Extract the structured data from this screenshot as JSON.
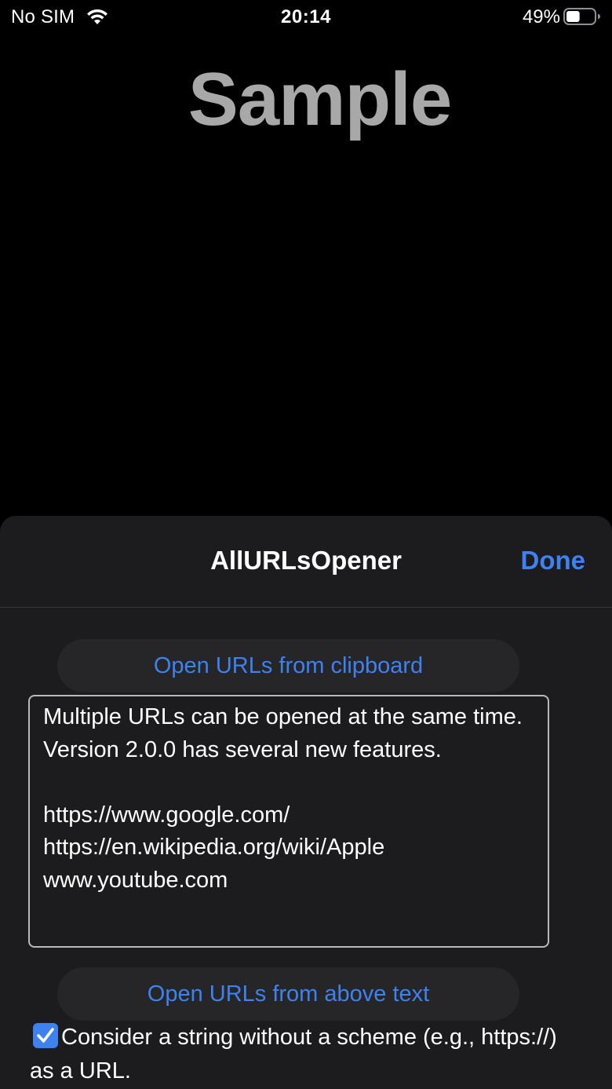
{
  "status_bar": {
    "carrier": "No SIM",
    "time": "20:14",
    "battery_percent": "49%",
    "battery_level": 0.49,
    "wifi_icon": "wifi-icon",
    "battery_icon": "battery-icon"
  },
  "background": {
    "title": "Sample"
  },
  "sheet": {
    "title": "AllURLsOpener",
    "done_label": "Done",
    "open_clipboard_label": "Open URLs from clipboard",
    "text_content": "Multiple URLs can be opened at the same time.\nVersion 2.0.0 has several new features.\n\nhttps://www.google.com/\nhttps://en.wikipedia.org/wiki/Apple\nwww.youtube.com",
    "open_text_label": "Open URLs from above text",
    "checkbox_checked": true,
    "checkbox_label": "Consider a string without a scheme (e.g., https://) as a URL."
  },
  "colors": {
    "accent": "#3d82f0",
    "sheet_background": "#1c1c1e",
    "button_background": "#262628",
    "background_title": "#a8a8a8"
  }
}
